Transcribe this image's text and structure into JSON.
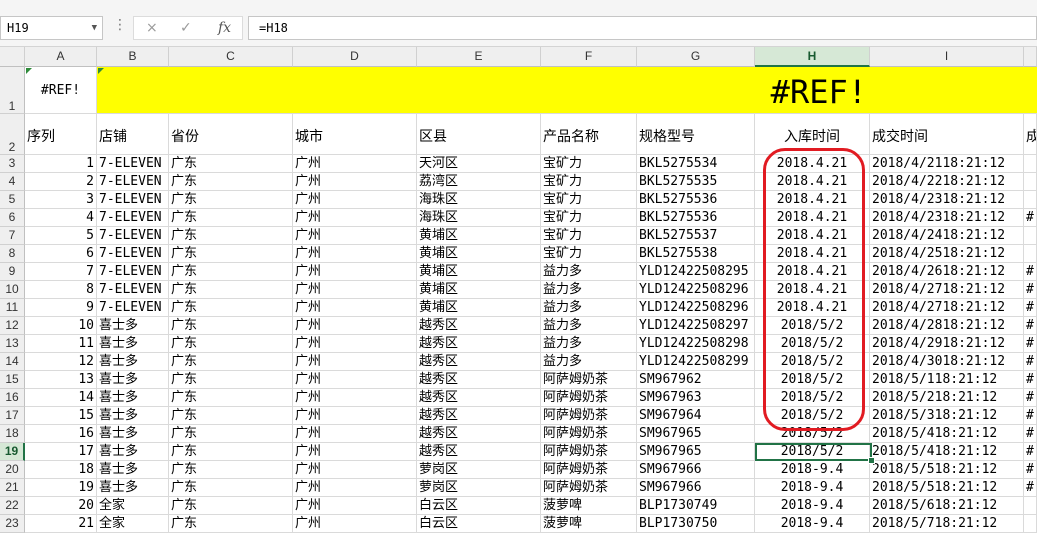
{
  "name_box": "H19",
  "formula_bar": {
    "cancel_icon": "×",
    "enter_icon": "✓",
    "fx_icon": "fx",
    "formula": "=H18"
  },
  "columns": [
    "A",
    "B",
    "C",
    "D",
    "E",
    "F",
    "G",
    "H",
    "I"
  ],
  "selected_column": "H",
  "selected_row": 19,
  "row1": {
    "a1": "#REF!",
    "banner": "#REF!"
  },
  "row2_headers": [
    "序列",
    "店铺",
    "省份",
    "城市",
    "区县",
    "产品名称",
    "规格型号",
    "入库时间",
    "成交时间",
    "成"
  ],
  "rows": [
    {
      "row": 3,
      "seq": "1",
      "store": "7-ELEVEN",
      "prov": "广东",
      "city": "广州",
      "dist": "天河区",
      "prod": "宝矿力",
      "spec": "BKL5275534",
      "in": "2018.4.21",
      "deal": "2018/4/2118:21:12",
      "extra": ""
    },
    {
      "row": 4,
      "seq": "2",
      "store": "7-ELEVEN",
      "prov": "广东",
      "city": "广州",
      "dist": "荔湾区",
      "prod": "宝矿力",
      "spec": "BKL5275535",
      "in": "2018.4.21",
      "deal": "2018/4/2218:21:12",
      "extra": ""
    },
    {
      "row": 5,
      "seq": "3",
      "store": "7-ELEVEN",
      "prov": "广东",
      "city": "广州",
      "dist": "海珠区",
      "prod": "宝矿力",
      "spec": "BKL5275536",
      "in": "2018.4.21",
      "deal": "2018/4/2318:21:12",
      "extra": ""
    },
    {
      "row": 6,
      "seq": "4",
      "store": "7-ELEVEN",
      "prov": "广东",
      "city": "广州",
      "dist": "海珠区",
      "prod": "宝矿力",
      "spec": "BKL5275536",
      "in": "2018.4.21",
      "deal": "2018/4/2318:21:12",
      "extra": "#"
    },
    {
      "row": 7,
      "seq": "5",
      "store": "7-ELEVEN",
      "prov": "广东",
      "city": "广州",
      "dist": "黄埔区",
      "prod": "宝矿力",
      "spec": "BKL5275537",
      "in": "2018.4.21",
      "deal": "2018/4/2418:21:12",
      "extra": ""
    },
    {
      "row": 8,
      "seq": "6",
      "store": "7-ELEVEN",
      "prov": "广东",
      "city": "广州",
      "dist": "黄埔区",
      "prod": "宝矿力",
      "spec": "BKL5275538",
      "in": "2018.4.21",
      "deal": "2018/4/2518:21:12",
      "extra": ""
    },
    {
      "row": 9,
      "seq": "7",
      "store": "7-ELEVEN",
      "prov": "广东",
      "city": "广州",
      "dist": "黄埔区",
      "prod": "益力多",
      "spec": "YLD12422508295",
      "in": "2018.4.21",
      "deal": "2018/4/2618:21:12",
      "extra": "#"
    },
    {
      "row": 10,
      "seq": "8",
      "store": "7-ELEVEN",
      "prov": "广东",
      "city": "广州",
      "dist": "黄埔区",
      "prod": "益力多",
      "spec": "YLD12422508296",
      "in": "2018.4.21",
      "deal": "2018/4/2718:21:12",
      "extra": "#"
    },
    {
      "row": 11,
      "seq": "9",
      "store": "7-ELEVEN",
      "prov": "广东",
      "city": "广州",
      "dist": "黄埔区",
      "prod": "益力多",
      "spec": "YLD12422508296",
      "in": "2018.4.21",
      "deal": "2018/4/2718:21:12",
      "extra": "#"
    },
    {
      "row": 12,
      "seq": "10",
      "store": "喜士多",
      "prov": "广东",
      "city": "广州",
      "dist": "越秀区",
      "prod": "益力多",
      "spec": "YLD12422508297",
      "in": "2018/5/2",
      "deal": "2018/4/2818:21:12",
      "extra": "#"
    },
    {
      "row": 13,
      "seq": "11",
      "store": "喜士多",
      "prov": "广东",
      "city": "广州",
      "dist": "越秀区",
      "prod": "益力多",
      "spec": "YLD12422508298",
      "in": "2018/5/2",
      "deal": "2018/4/2918:21:12",
      "extra": "#"
    },
    {
      "row": 14,
      "seq": "12",
      "store": "喜士多",
      "prov": "广东",
      "city": "广州",
      "dist": "越秀区",
      "prod": "益力多",
      "spec": "YLD12422508299",
      "in": "2018/5/2",
      "deal": "2018/4/3018:21:12",
      "extra": "#"
    },
    {
      "row": 15,
      "seq": "13",
      "store": "喜士多",
      "prov": "广东",
      "city": "广州",
      "dist": "越秀区",
      "prod": "阿萨姆奶茶",
      "spec": "SM967962",
      "in": "2018/5/2",
      "deal": "2018/5/118:21:12",
      "extra": "#"
    },
    {
      "row": 16,
      "seq": "14",
      "store": "喜士多",
      "prov": "广东",
      "city": "广州",
      "dist": "越秀区",
      "prod": "阿萨姆奶茶",
      "spec": "SM967963",
      "in": "2018/5/2",
      "deal": "2018/5/218:21:12",
      "extra": "#"
    },
    {
      "row": 17,
      "seq": "15",
      "store": "喜士多",
      "prov": "广东",
      "city": "广州",
      "dist": "越秀区",
      "prod": "阿萨姆奶茶",
      "spec": "SM967964",
      "in": "2018/5/2",
      "deal": "2018/5/318:21:12",
      "extra": "#"
    },
    {
      "row": 18,
      "seq": "16",
      "store": "喜士多",
      "prov": "广东",
      "city": "广州",
      "dist": "越秀区",
      "prod": "阿萨姆奶茶",
      "spec": "SM967965",
      "in": "2018/5/2",
      "deal": "2018/5/418:21:12",
      "extra": "#"
    },
    {
      "row": 19,
      "seq": "17",
      "store": "喜士多",
      "prov": "广东",
      "city": "广州",
      "dist": "越秀区",
      "prod": "阿萨姆奶茶",
      "spec": "SM967965",
      "in": "2018/5/2",
      "deal": "2018/5/418:21:12",
      "extra": "#"
    },
    {
      "row": 20,
      "seq": "18",
      "store": "喜士多",
      "prov": "广东",
      "city": "广州",
      "dist": "萝岗区",
      "prod": "阿萨姆奶茶",
      "spec": "SM967966",
      "in": "2018-9.4",
      "deal": "2018/5/518:21:12",
      "extra": "#"
    },
    {
      "row": 21,
      "seq": "19",
      "store": "喜士多",
      "prov": "广东",
      "city": "广州",
      "dist": "萝岗区",
      "prod": "阿萨姆奶茶",
      "spec": "SM967966",
      "in": "2018-9.4",
      "deal": "2018/5/518:21:12",
      "extra": "#"
    },
    {
      "row": 22,
      "seq": "20",
      "store": "全家",
      "prov": "广东",
      "city": "广州",
      "dist": "白云区",
      "prod": "菠萝啤",
      "spec": "BLP1730749",
      "in": "2018-9.4",
      "deal": "2018/5/618:21:12",
      "extra": ""
    },
    {
      "row": 23,
      "seq": "21",
      "store": "全家",
      "prov": "广东",
      "city": "广州",
      "dist": "白云区",
      "prod": "菠萝啤",
      "spec": "BLP1730750",
      "in": "2018-9.4",
      "deal": "2018/5/718:21:12",
      "extra": ""
    }
  ],
  "colors": {
    "banner": "#ffff00",
    "highlight": "#e11b22",
    "selection": "#217346"
  }
}
